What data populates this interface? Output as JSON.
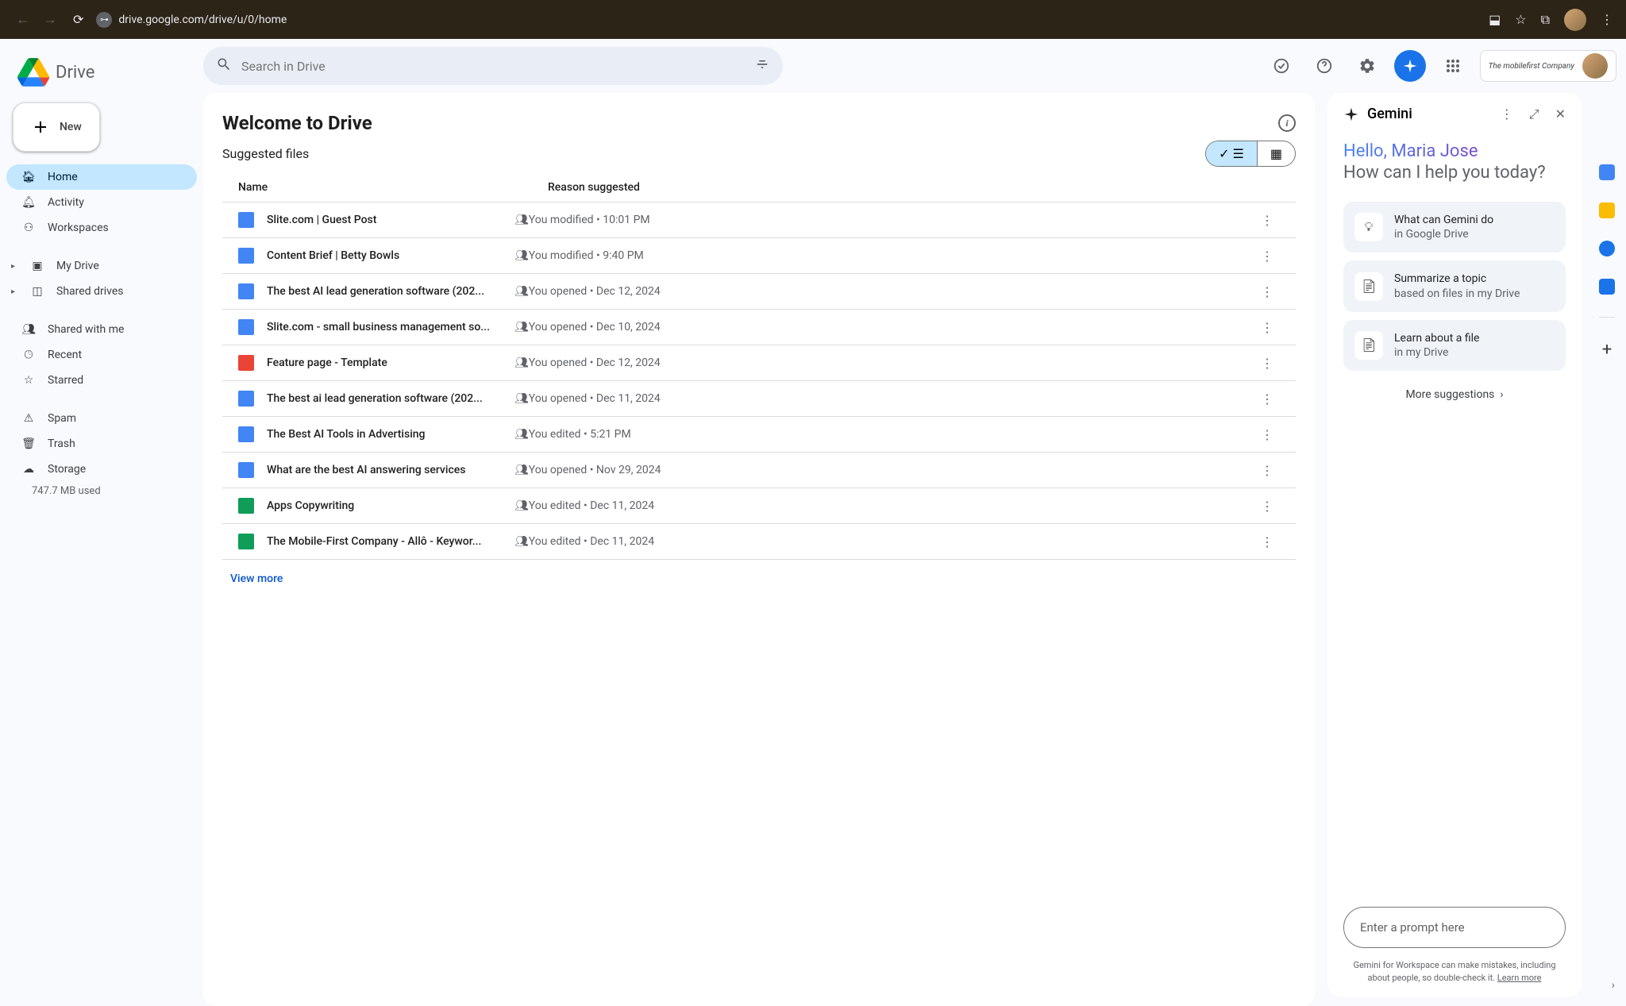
{
  "browser": {
    "url": "drive.google.com/drive/u/0/home"
  },
  "logo_text": "Drive",
  "new_btn": "New",
  "search_placeholder": "Search in Drive",
  "company_chip": "The mobilefirst Company",
  "sidebar": {
    "home": "Home",
    "activity": "Activity",
    "workspaces": "Workspaces",
    "mydrive": "My Drive",
    "shareddrives": "Shared drives",
    "sharedwithme": "Shared with me",
    "recent": "Recent",
    "starred": "Starred",
    "spam": "Spam",
    "trash": "Trash",
    "storage": "Storage",
    "storage_used": "747.7 MB used"
  },
  "main": {
    "welcome": "Welcome to Drive",
    "suggested": "Suggested files",
    "col_name": "Name",
    "col_reason": "Reason suggested",
    "view_more": "View more",
    "files": [
      {
        "name": "Slite.com | Guest Post",
        "reason": "You modified • 10:01 PM",
        "type": "doc",
        "shared": true
      },
      {
        "name": "Content Brief | Betty Bowls",
        "reason": "You modified • 9:40 PM",
        "type": "doc",
        "shared": true
      },
      {
        "name": "The best AI lead generation software (202...",
        "reason": "You opened • Dec 12, 2024",
        "type": "doc",
        "shared": true
      },
      {
        "name": "Slite.com - small business management so...",
        "reason": "You opened • Dec 10, 2024",
        "type": "doc",
        "shared": true
      },
      {
        "name": "Feature page - Template",
        "reason": "You opened • Dec 12, 2024",
        "type": "red",
        "shared": true
      },
      {
        "name": "The best ai lead generation software (202...",
        "reason": "You opened • Dec 11, 2024",
        "type": "doc",
        "shared": true
      },
      {
        "name": "The Best AI Tools in Advertising",
        "reason": "You edited • 5:21 PM",
        "type": "doc",
        "shared": true
      },
      {
        "name": "What are the best AI answering services",
        "reason": "You opened • Nov 29, 2024",
        "type": "doc",
        "shared": true
      },
      {
        "name": "Apps Copywriting",
        "reason": "You edited • Dec 11, 2024",
        "type": "sheet",
        "shared": true
      },
      {
        "name": "The Mobile-First Company - Allô - Keywor...",
        "reason": "You edited • Dec 11, 2024",
        "type": "sheet",
        "shared": true
      }
    ]
  },
  "gemini": {
    "title": "Gemini",
    "hello": "Hello, Maria Jose",
    "sub": "How can I help you today?",
    "suggestions": [
      {
        "line1": "What can Gemini do",
        "line2": "in Google Drive",
        "icon": "bulb"
      },
      {
        "line1": "Summarize a topic",
        "line2": "based on files in my Drive",
        "icon": "doc"
      },
      {
        "line1": "Learn about a file",
        "line2": "in my Drive",
        "icon": "doc"
      }
    ],
    "more": "More suggestions",
    "prompt_placeholder": "Enter a prompt here",
    "disclaimer": "Gemini for Workspace can make mistakes, including about people, so double-check it. ",
    "learn_more": "Learn more"
  }
}
